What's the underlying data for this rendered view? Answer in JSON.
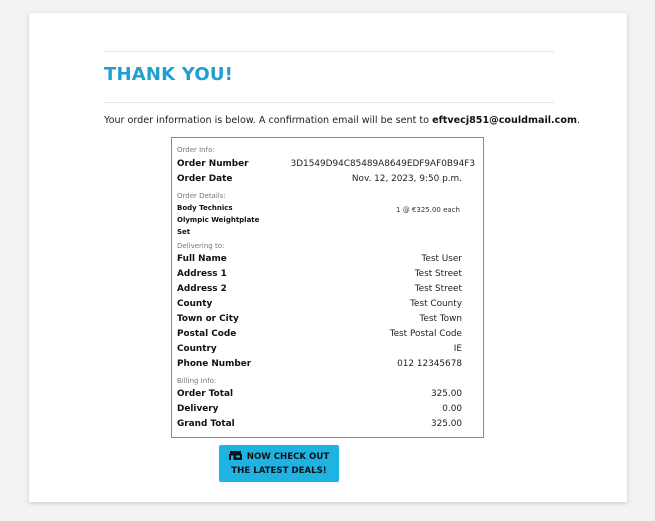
{
  "header": {
    "title": "THANK YOU!",
    "intro_prefix": "Your order information is below. A confirmation email will be sent to ",
    "email": "eftvecj851@couldmail.com",
    "intro_suffix": "."
  },
  "order_info": {
    "section_label": "Order Info:",
    "order_number_label": "Order Number",
    "order_number": "3D1549D94C85489A8649EDF9AF0B94F3",
    "order_date_label": "Order Date",
    "order_date": "Nov. 12, 2023, 9:50 p.m."
  },
  "order_details": {
    "section_label": "Order Details:",
    "product_line1": "Body Technics",
    "product_line2": "Olympic Weightplate",
    "product_line3": "Set",
    "quantity_price": "1 @ €325.00 each"
  },
  "delivery": {
    "section_label": "Delivering to:",
    "rows": [
      {
        "label": "Full Name",
        "value": "Test User"
      },
      {
        "label": "Address 1",
        "value": "Test Street"
      },
      {
        "label": "Address 2",
        "value": "Test Street"
      },
      {
        "label": "County",
        "value": "Test County"
      },
      {
        "label": "Town or City",
        "value": "Test Town"
      },
      {
        "label": "Postal Code",
        "value": "Test Postal Code"
      },
      {
        "label": "Country",
        "value": "IE"
      },
      {
        "label": "Phone Number",
        "value": "012 12345678"
      }
    ]
  },
  "billing": {
    "section_label": "Billing Info:",
    "rows": [
      {
        "label": "Order Total",
        "value": "325.00"
      },
      {
        "label": "Delivery",
        "value": "0.00"
      },
      {
        "label": "Grand Total",
        "value": "325.00"
      }
    ]
  },
  "cta": {
    "line1": "NOW CHECK OUT",
    "line2": "THE LATEST DEALS!",
    "icon": "shop-icon"
  },
  "colors": {
    "accent": "#1e9fd0",
    "button": "#1fb3e3",
    "page_background": "#f4f2f2"
  }
}
